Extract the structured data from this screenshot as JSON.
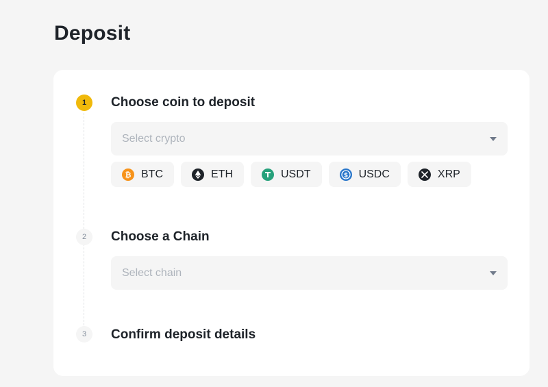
{
  "page": {
    "title": "Deposit"
  },
  "steps": [
    {
      "number": "1",
      "title": "Choose coin to deposit",
      "active": true
    },
    {
      "number": "2",
      "title": "Choose a Chain",
      "active": false
    },
    {
      "number": "3",
      "title": "Confirm deposit details",
      "active": false
    }
  ],
  "coin_select": {
    "placeholder": "Select crypto"
  },
  "chain_select": {
    "placeholder": "Select chain"
  },
  "coins": [
    {
      "symbol": "BTC",
      "icon": "btc-icon",
      "color": "#f7931a"
    },
    {
      "symbol": "ETH",
      "icon": "eth-icon",
      "color": "#1e2329"
    },
    {
      "symbol": "USDT",
      "icon": "usdt-icon",
      "color": "#26a17b"
    },
    {
      "symbol": "USDC",
      "icon": "usdc-icon",
      "color": "#2775ca"
    },
    {
      "symbol": "XRP",
      "icon": "xrp-icon",
      "color": "#1e2329"
    }
  ],
  "colors": {
    "accent": "#f0b90b",
    "background": "#f5f5f5",
    "card": "#ffffff"
  }
}
